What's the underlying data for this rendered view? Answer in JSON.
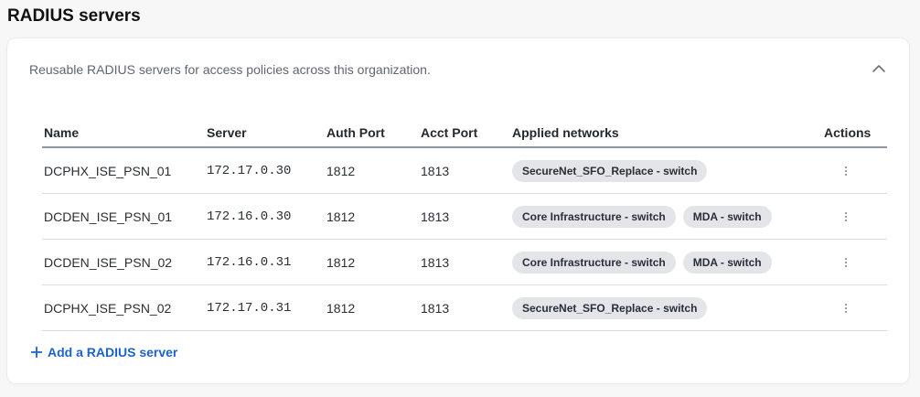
{
  "page": {
    "title": "RADIUS servers"
  },
  "card": {
    "description": "Reusable RADIUS servers for access policies across this organization.",
    "collapse_icon": "chevron-up-icon"
  },
  "table": {
    "headers": {
      "name": "Name",
      "server": "Server",
      "auth_port": "Auth Port",
      "acct_port": "Acct Port",
      "applied_networks": "Applied networks",
      "actions": "Actions"
    },
    "rows": [
      {
        "name": "DCPHX_ISE_PSN_01",
        "server": "172.17.0.30",
        "auth_port": "1812",
        "acct_port": "1813",
        "networks": [
          "SecureNet_SFO_Replace - switch"
        ]
      },
      {
        "name": "DCDEN_ISE_PSN_01",
        "server": "172.16.0.30",
        "auth_port": "1812",
        "acct_port": "1813",
        "networks": [
          "Core Infrastructure - switch",
          "MDA - switch"
        ]
      },
      {
        "name": "DCDEN_ISE_PSN_02",
        "server": "172.16.0.31",
        "auth_port": "1812",
        "acct_port": "1813",
        "networks": [
          "Core Infrastructure - switch",
          "MDA - switch"
        ]
      },
      {
        "name": "DCPHX_ISE_PSN_02",
        "server": "172.17.0.31",
        "auth_port": "1812",
        "acct_port": "1813",
        "networks": [
          "SecureNet_SFO_Replace - switch"
        ]
      }
    ],
    "row_action_icon": "kebab-menu-icon"
  },
  "add_button": {
    "label": "Add a RADIUS server",
    "icon": "plus-icon"
  },
  "colors": {
    "link": "#1d63c7",
    "pill_bg": "#e3e5e8",
    "header_rule": "#8f959c"
  }
}
